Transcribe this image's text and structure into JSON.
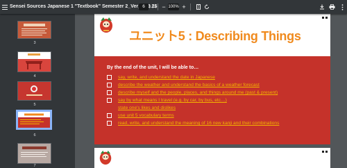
{
  "toolbar": {
    "title": "Sensei Sources Japanese 1 \"Textbook\" Semester 2_Ver_1.23.25",
    "page_current": "6",
    "page_total": "/ 74",
    "zoom": "100%",
    "zoom_out_label": "−",
    "zoom_in_label": "+"
  },
  "sidebar": {
    "thumbnails": [
      {
        "label": "3"
      },
      {
        "label": "4"
      },
      {
        "label": "5"
      },
      {
        "label": "6"
      },
      {
        "label": "7"
      }
    ]
  },
  "slide": {
    "title": "ユニット5 : Describing Things",
    "intro": "By the end of the unit, I will be able to…",
    "goals": [
      "say, write, and understand the date in Japanese",
      "describe the weather and understand the basics of a weather forecast",
      "describe myself and the people, places, and things around me (past & present)",
      "say by what means I travel (e.g. by car, by bus, etc…)",
      "state one's likes and dislikes",
      "use unit 5 vocabulary terms",
      "read, write, and understand the meaning of 16 new kanji and their combinations"
    ]
  },
  "colors": {
    "toolbar": "#323639",
    "viewer_bg": "#525659",
    "slide_red": "#c5322a",
    "title_orange": "#f08a1d",
    "goal_yellow": "#f4b400",
    "selected_thumb": "#8ab4f8"
  }
}
